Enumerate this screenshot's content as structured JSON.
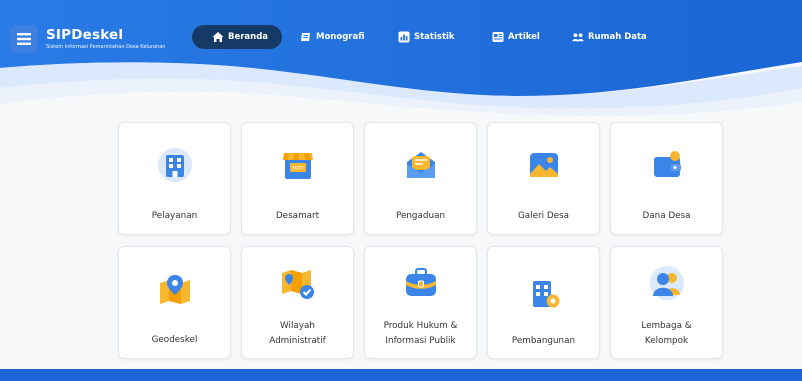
{
  "brand": {
    "name": "SIPDeskel",
    "subtitle": "Sistem Informasi Pemerintahan Desa Kelurahan"
  },
  "nav": {
    "items": [
      {
        "label": "Beranda",
        "icon": "home-icon",
        "active": true
      },
      {
        "label": "Monografi",
        "icon": "note-icon",
        "active": false
      },
      {
        "label": "Statistik",
        "icon": "stats-icon",
        "active": false
      },
      {
        "label": "Artikel",
        "icon": "news-icon",
        "active": false
      },
      {
        "label": "Rumah Data",
        "icon": "people-icon",
        "active": false
      }
    ]
  },
  "menu": {
    "items": [
      {
        "label": "Pelayanan",
        "icon": "building-icon"
      },
      {
        "label": "Desamart",
        "icon": "store-icon"
      },
      {
        "label": "Pengaduan",
        "icon": "message-icon"
      },
      {
        "label": "Galeri Desa",
        "icon": "image-icon"
      },
      {
        "label": "Dana Desa",
        "icon": "wallet-icon"
      },
      {
        "label": "Geodeskel",
        "icon": "map-icon"
      },
      {
        "label_line1": "Wilayah",
        "label_line2": "Administratif",
        "icon": "map-check-icon"
      },
      {
        "label_line1": "Produk Hukum &",
        "label_line2": "Informasi Publik",
        "icon": "briefcase-icon"
      },
      {
        "label": "Pembangunan",
        "icon": "building-gear-icon"
      },
      {
        "label_line1": "Lembaga &",
        "label_line2": "Kelompok",
        "icon": "group-icon"
      }
    ]
  },
  "colors": {
    "header": "#1f6fe0",
    "nav_active": "#163a66",
    "footer": "#1d64d8"
  }
}
